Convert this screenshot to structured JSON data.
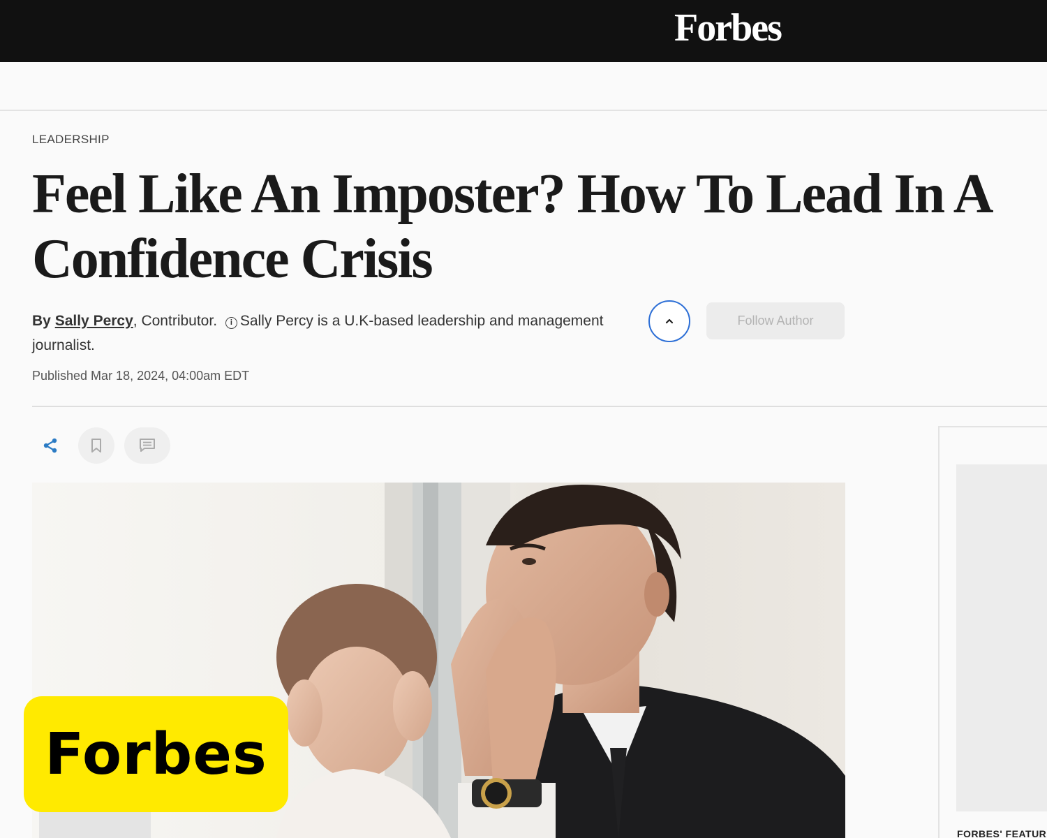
{
  "site": {
    "logo": "Forbes"
  },
  "article": {
    "section": "LEADERSHIP",
    "headline_line1": "Feel Like An Imposter? How To Lead In A",
    "headline_line2": "Confidence Crisis",
    "by_label": "By",
    "author": "Sally Percy",
    "author_role": ", Contributor.",
    "info_glyph": "i",
    "author_bio": "Sally Percy is a U.K-based leadership and management journalist.",
    "follow_label": "Follow Author",
    "published": "Published Mar 18, 2024, 04:00am EDT"
  },
  "sidebar": {
    "label": "FORBES' FEATUR"
  },
  "badge": {
    "text": "Forbes",
    "color": "#ffea00"
  },
  "icons": {
    "share": "share-icon",
    "save": "bookmark-icon",
    "comment": "comment-icon",
    "collapse": "chevron-up-icon"
  },
  "colors": {
    "topbar": "#111111",
    "accent_blue": "#2d6fd6",
    "share_blue": "#2b7bc4"
  }
}
